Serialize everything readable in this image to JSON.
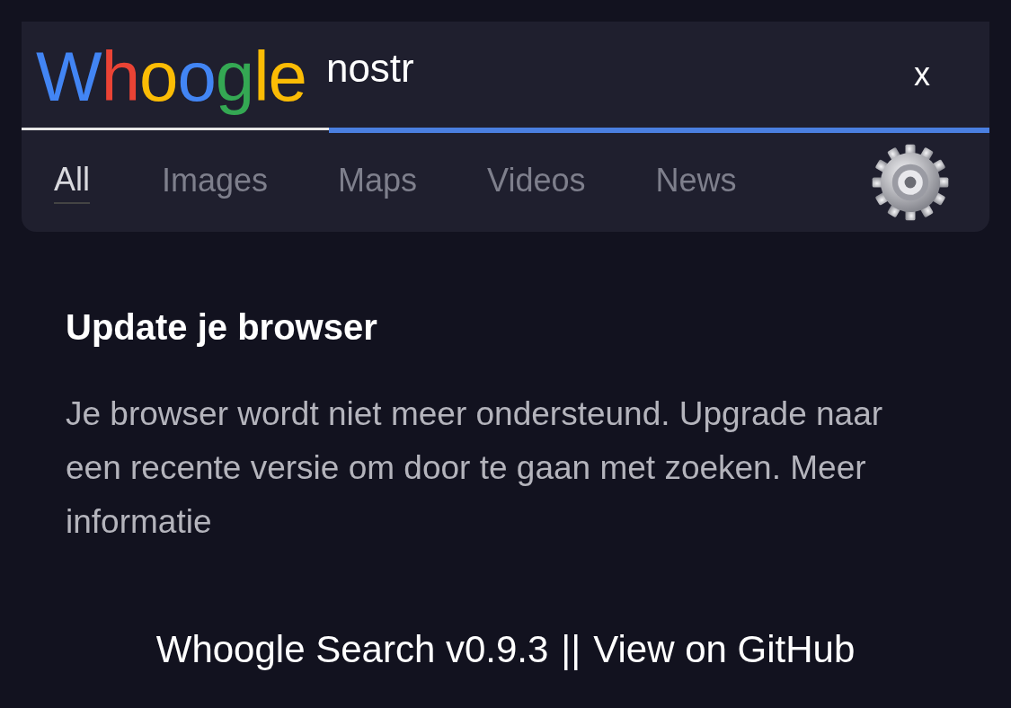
{
  "logo": [
    {
      "letter": "W",
      "color": "#4285f4"
    },
    {
      "letter": "h",
      "color": "#ea4335"
    },
    {
      "letter": "o",
      "color": "#fbbc05"
    },
    {
      "letter": "o",
      "color": "#4285f4"
    },
    {
      "letter": "g",
      "color": "#34a853"
    },
    {
      "letter": "l",
      "color": "#fbbc05"
    },
    {
      "letter": "e",
      "color": "#fbbc05"
    }
  ],
  "search": {
    "value": "nostr",
    "clear": "x"
  },
  "tabs": [
    {
      "label": "All",
      "selected": true
    },
    {
      "label": "Images",
      "selected": false
    },
    {
      "label": "Maps",
      "selected": false
    },
    {
      "label": "Videos",
      "selected": false
    },
    {
      "label": "News",
      "selected": false
    }
  ],
  "notice": {
    "title": "Update je browser",
    "text": "Je browser wordt niet meer ondersteund. Upgrade naar een recente versie om door te gaan met zoeken. Meer informatie"
  },
  "footer": {
    "version_link": "Whoogle Search v0.9.3",
    "separator": "||",
    "github_link": "View on GitHub"
  }
}
